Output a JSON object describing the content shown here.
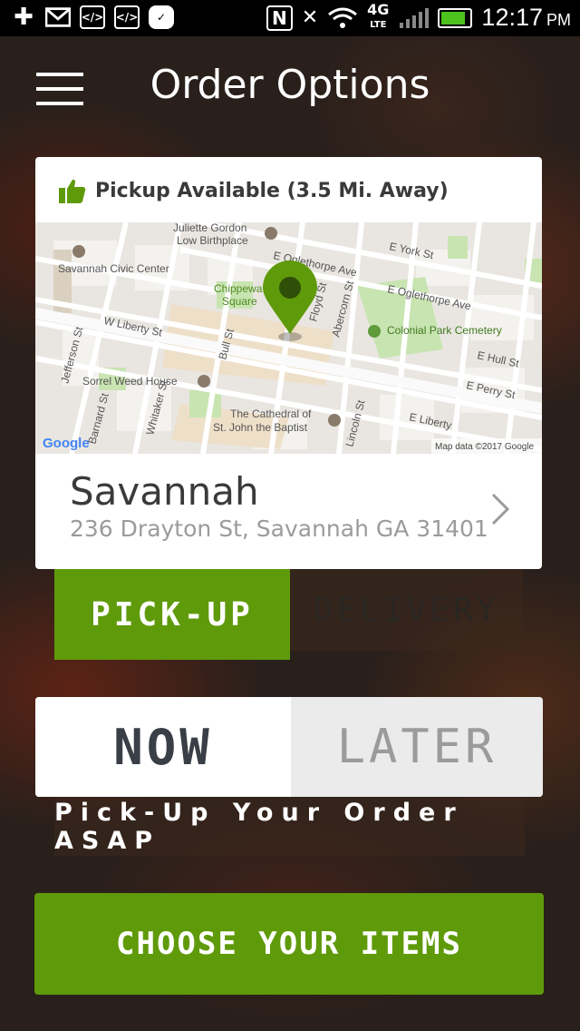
{
  "status_bar": {
    "time": "12:17",
    "ampm": "PM",
    "network": "4G",
    "network_sub": "LTE"
  },
  "header": {
    "title": "Order Options"
  },
  "location_card": {
    "availability": "Pickup Available (3.5 Mi. Away)",
    "name": "Savannah",
    "address": "236 Drayton St, Savannah GA 31401"
  },
  "map": {
    "labels": {
      "juliette": "Juliette Gordon",
      "juliette2": "Low Birthplace",
      "civic": "Savannah Civic Center",
      "york": "E York St",
      "oglethorpe1": "E Oglethorpe Ave",
      "oglethorpe2": "E Oglethorpe Ave",
      "chippewa": "Chippewa",
      "square": "Square",
      "colonial": "Colonial Park Cemetery",
      "liberty_w": "W Liberty St",
      "floyd": "Floyd St",
      "abercorn": "Abercorn St",
      "hull": "E Hull St",
      "perry": "E Perry St",
      "bull": "Bull St",
      "jefferson": "Jefferson St",
      "sorrel": "Sorrel Weed House",
      "whitaker": "Whitaker St",
      "barnard": "Barnard St",
      "cathedral1": "The Cathedral of",
      "cathedral2": "St. John the Baptist",
      "liberty_e": "E Liberty",
      "lincoln": "Lincoln St",
      "google": "Google",
      "attribution": "Map data ©2017 Google"
    }
  },
  "fulfillment_tabs": {
    "pickup": "PICK-UP",
    "delivery": "DELIVERY"
  },
  "timing": {
    "now": "NOW",
    "later": "LATER",
    "message": "Pick-Up Your Order ASAP"
  },
  "cta": {
    "label": "CHOOSE YOUR ITEMS"
  },
  "colors": {
    "brand_green": "#5f9a0b",
    "pin_green": "#5f9a0b"
  }
}
